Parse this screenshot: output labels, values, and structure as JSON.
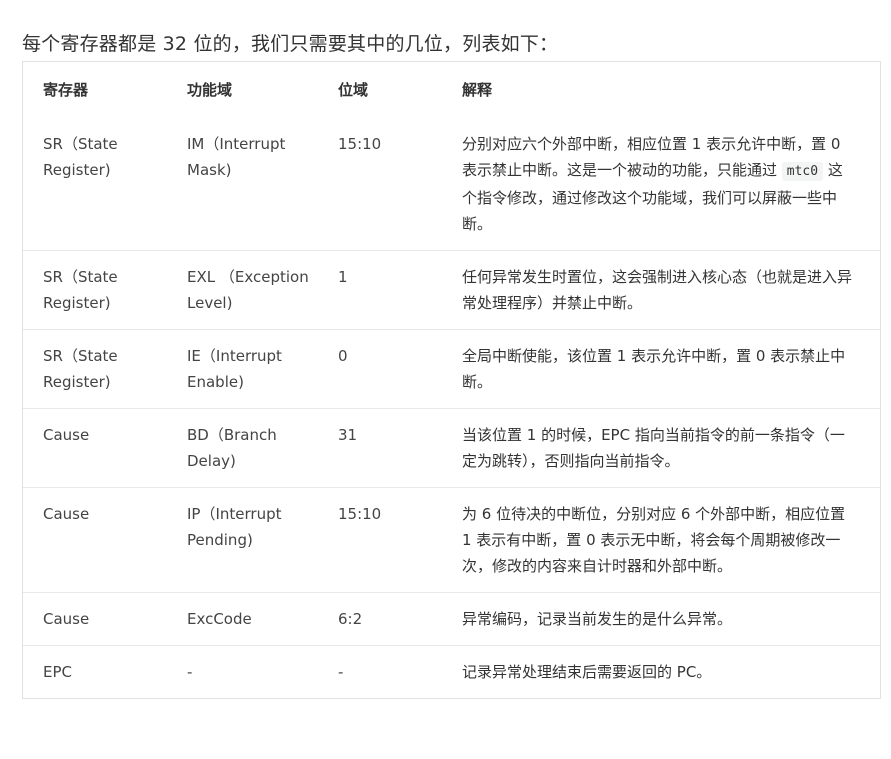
{
  "intro": "每个寄存器都是 32 位的，我们只需要其中的几位，列表如下：",
  "headers": {
    "register": "寄存器",
    "field": "功能域",
    "bits": "位域",
    "explanation": "解释"
  },
  "rows": [
    {
      "register": "SR（State Register)",
      "field": "IM（Interrupt Mask)",
      "bits": "15:10",
      "desc_before": "分别对应六个外部中断，相应位置 1 表示允许中断，置 0 表示禁止中断。这是一个被动的功能，只能通过 ",
      "code": "mtc0",
      "desc_after": " 这个指令修改，通过修改这个功能域，我们可以屏蔽一些中断。"
    },
    {
      "register": "SR（State Register)",
      "field": "EXL （Exception Level)",
      "bits": "1",
      "desc_before": "任何异常发生时置位，这会强制进入核心态（也就是进入异常处理程序）并禁止中断。",
      "code": "",
      "desc_after": ""
    },
    {
      "register": "SR（State Register)",
      "field": "IE（Interrupt Enable)",
      "bits": "0",
      "desc_before": "全局中断使能，该位置 1 表示允许中断，置 0 表示禁止中断。",
      "code": "",
      "desc_after": ""
    },
    {
      "register": "Cause",
      "field": "BD（Branch Delay)",
      "bits": "31",
      "desc_before": "当该位置 1 的时候，EPC 指向当前指令的前一条指令（一定为跳转），否则指向当前指令。",
      "code": "",
      "desc_after": ""
    },
    {
      "register": "Cause",
      "field": "IP（Interrupt Pending)",
      "bits": "15:10",
      "desc_before": "为 6 位待决的中断位，分别对应 6 个外部中断，相应位置 1 表示有中断，置 0 表示无中断，将会每个周期被修改一次，修改的内容来自计时器和外部中断。",
      "code": "",
      "desc_after": ""
    },
    {
      "register": "Cause",
      "field": "ExcCode",
      "bits": "6:2",
      "desc_before": "异常编码，记录当前发生的是什么异常。",
      "code": "",
      "desc_after": ""
    },
    {
      "register": "EPC",
      "field": "-",
      "bits": "-",
      "desc_before": "记录异常处理结束后需要返回的 PC。",
      "code": "",
      "desc_after": ""
    }
  ]
}
